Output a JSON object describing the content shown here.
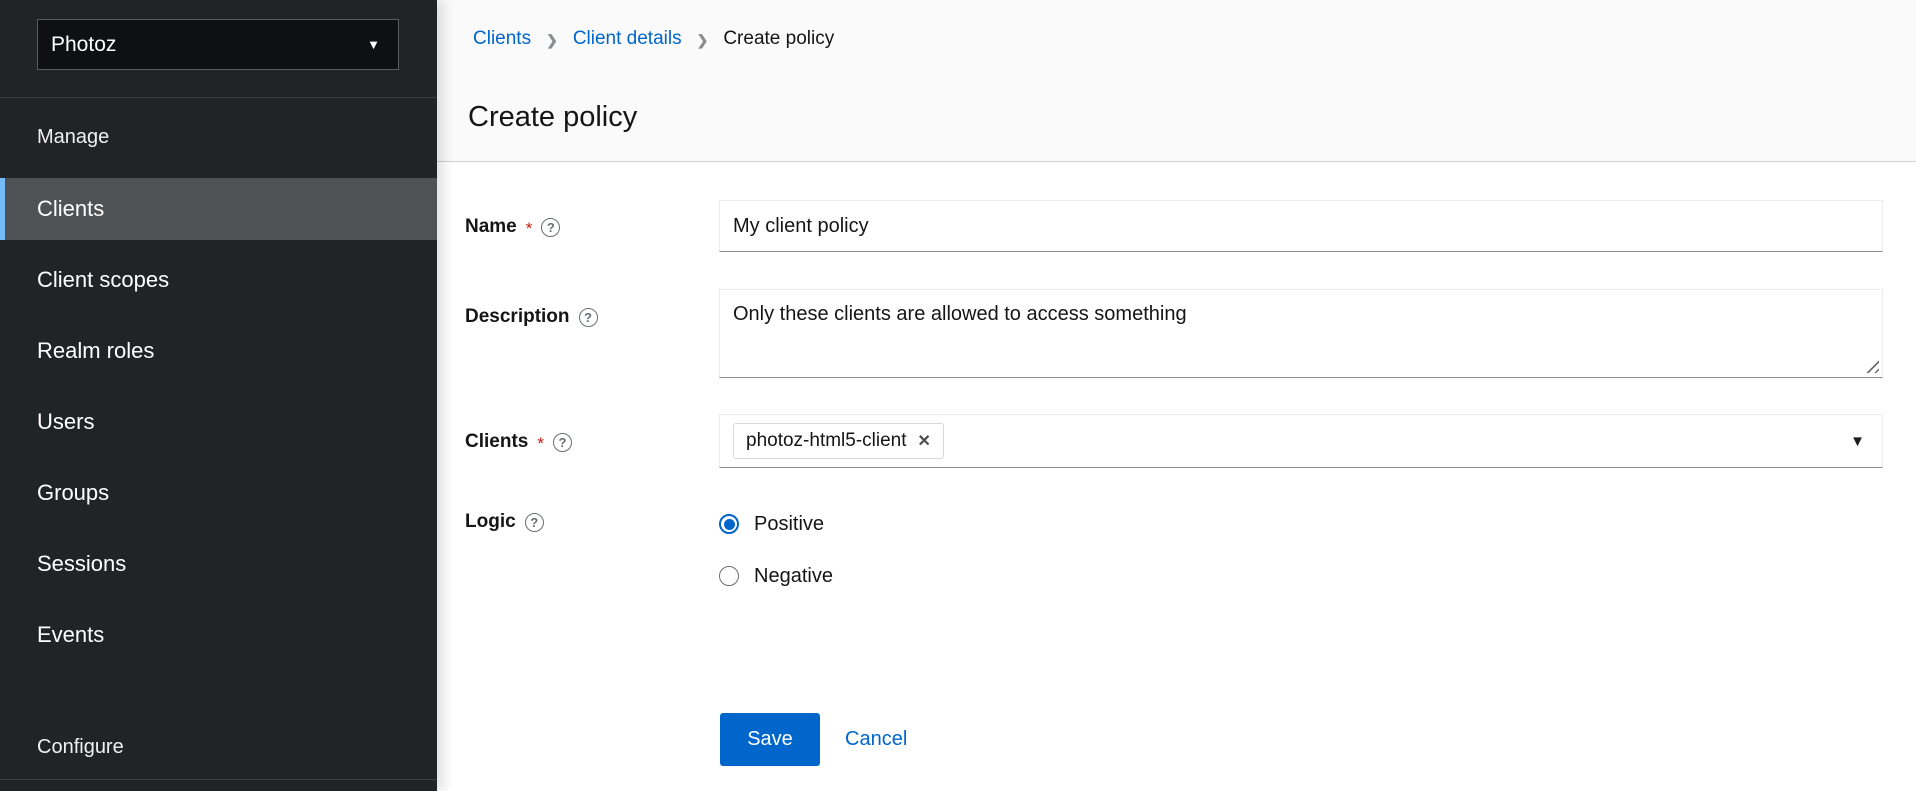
{
  "sidebar": {
    "realm_selector": {
      "value": "Photoz"
    },
    "sections": [
      {
        "label": "Manage",
        "items": [
          {
            "label": "Clients",
            "selected": true
          },
          {
            "label": "Client scopes",
            "selected": false
          },
          {
            "label": "Realm roles",
            "selected": false
          },
          {
            "label": "Users",
            "selected": false
          },
          {
            "label": "Groups",
            "selected": false
          },
          {
            "label": "Sessions",
            "selected": false
          },
          {
            "label": "Events",
            "selected": false
          }
        ]
      },
      {
        "label": "Configure",
        "items": []
      }
    ]
  },
  "breadcrumb": [
    {
      "label": "Clients",
      "type": "link"
    },
    {
      "label": "Client details",
      "type": "link"
    },
    {
      "label": "Create policy",
      "type": "current"
    }
  ],
  "page": {
    "title": "Create policy"
  },
  "form": {
    "required_indicator": "*",
    "name": {
      "label": "Name",
      "required": true,
      "value": "My client policy"
    },
    "description": {
      "label": "Description",
      "value": "Only these clients are allowed to access something"
    },
    "clients": {
      "label": "Clients",
      "required": true,
      "chips": [
        "photoz-html5-client"
      ]
    },
    "logic": {
      "label": "Logic",
      "options": [
        {
          "label": "Positive",
          "selected": true
        },
        {
          "label": "Negative",
          "selected": false
        }
      ]
    },
    "actions": {
      "save": "Save",
      "cancel": "Cancel"
    }
  },
  "icons": {
    "help": "?",
    "caret_down": "▼",
    "chip_remove": "✕",
    "breadcrumb_separator": "❯"
  },
  "colors": {
    "accent": "#0066cc",
    "sidebar_bg": "#212427",
    "sidebar_selected_bg": "#4f5255",
    "sidebar_selected_accent": "#73bcf7",
    "required": "#c9190b",
    "input_border_bottom": "#8a8d90"
  }
}
